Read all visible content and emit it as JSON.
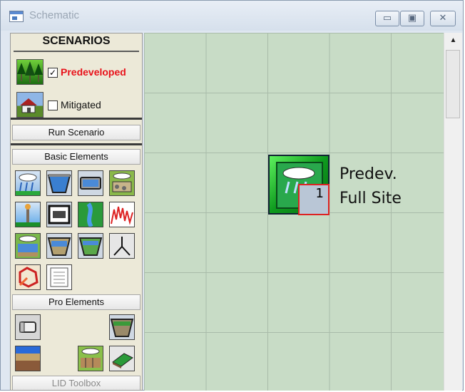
{
  "window": {
    "title": "Schematic",
    "controls": {
      "minimize_glyph": "▭",
      "maximize_glyph": "▣",
      "close_glyph": "✕"
    }
  },
  "scenarios": {
    "header": "SCENARIOS",
    "items": [
      {
        "label": "Predeveloped",
        "checked": true,
        "color": "#e8121a",
        "check_glyph": "✓"
      },
      {
        "label": "Mitigated",
        "checked": false,
        "color": "#111111",
        "check_glyph": ""
      }
    ]
  },
  "run_button": "Run Scenario",
  "sections": {
    "basic": "Basic Elements",
    "pro": "Pro Elements",
    "lid": "LID Toolbox"
  },
  "basic_tools": [
    "rain-gauge-icon",
    "trapezoidal-basin-icon",
    "tank-icon",
    "gravel-trench-icon",
    "tower-icon",
    "vault-icon",
    "channel-icon",
    "flow-duration-icon",
    "infiltration-icon",
    "pond-icon",
    "swale-icon",
    "junction-icon",
    "compass-icon",
    "table-icon"
  ],
  "pro_tools": [
    "pipe-icon",
    "bioretention-icon",
    "layered-soil-icon",
    "permeable-pavement-icon",
    "green-roof-icon"
  ],
  "canvas": {
    "node": {
      "label_line1": "Predev.",
      "label_line2": "Full Site",
      "badge": "1"
    },
    "scroll_up_glyph": "▲"
  },
  "colors": {
    "grid": "#c8dcc6",
    "node_green": "#0e9a1e",
    "badge_border": "#dd2222"
  }
}
